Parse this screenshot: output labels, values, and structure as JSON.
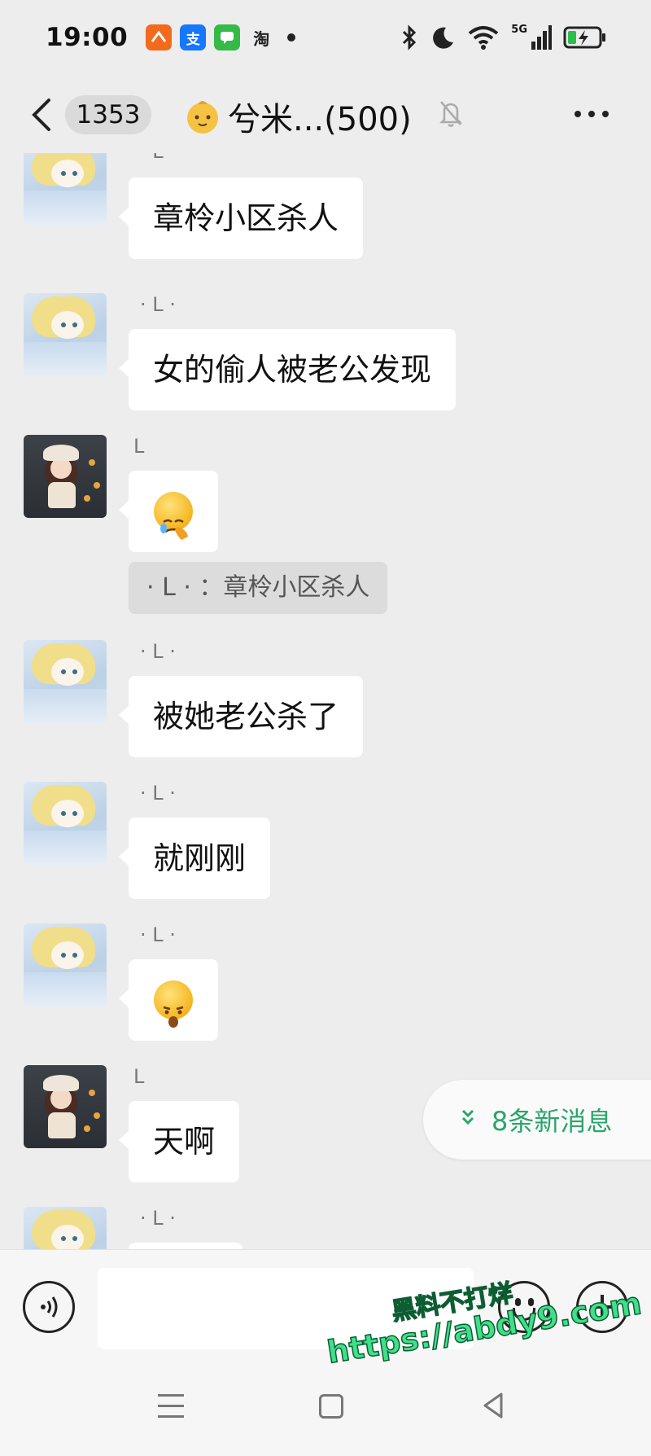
{
  "status_bar": {
    "time": "19:00",
    "apps": [
      {
        "icon": "app-badge-orange-icon",
        "glyph": "",
        "color": "#f26b1d"
      },
      {
        "icon": "alipay-icon",
        "glyph": "支",
        "color": "#1677ff"
      },
      {
        "icon": "messages-icon",
        "glyph": "",
        "color": "#35b948"
      },
      {
        "icon": "taobao-icon",
        "glyph": "淘",
        "color": "#222222"
      }
    ],
    "network": "5G",
    "icons": [
      "bluetooth-icon",
      "moon-icon",
      "wifi-icon",
      "signal-icon",
      "battery-charging-icon"
    ]
  },
  "header": {
    "unread_count": "1353",
    "title": "兮米...(500)",
    "icons": [
      "back-icon",
      "baby-face-emoji-icon",
      "mute-bell-icon",
      "more-icon"
    ]
  },
  "messages": [
    {
      "sender": "· L ·",
      "text": "章柃小区杀人",
      "avatar": "cartoon"
    },
    {
      "sender": "· L ·",
      "text": "女的偷人被老公发现",
      "avatar": "cartoon"
    },
    {
      "sender": "L",
      "text": "",
      "emoji": "facepalm-emoji-icon",
      "avatar": "girl",
      "quote": "· L · ：章柃小区杀人"
    },
    {
      "sender": "· L ·",
      "text": "被她老公杀了",
      "avatar": "cartoon"
    },
    {
      "sender": "· L ·",
      "text": "就刚刚",
      "avatar": "cartoon"
    },
    {
      "sender": "· L ·",
      "text": "",
      "emoji": "shocked-emoji-icon",
      "avatar": "cartoon"
    },
    {
      "sender": "L",
      "text": "天啊",
      "avatar": "girl"
    },
    {
      "sender": "· L ·",
      "text": "",
      "avatar": "cartoon"
    }
  ],
  "new_messages": "8条新消息",
  "input": {
    "placeholder": "",
    "value": ""
  },
  "watermark": {
    "line1": "黑料不打烊",
    "line2": "https://abdy9.com"
  },
  "colors": {
    "background": "#ededed",
    "bubble": "#ffffff",
    "accent_green": "#2aa56b"
  }
}
